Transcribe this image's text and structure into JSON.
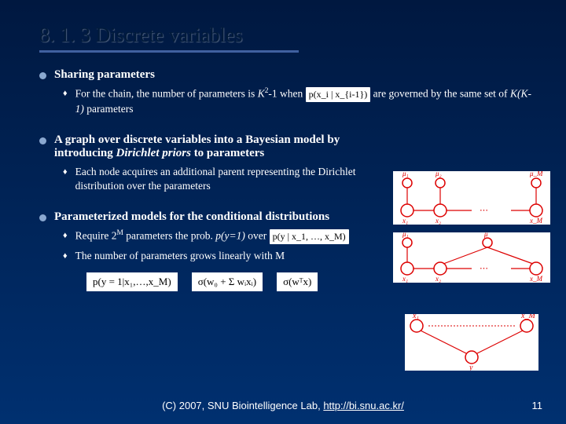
{
  "title": "8. 1. 3 Discrete variables",
  "bullets": {
    "b1": {
      "label": "Sharing parameters",
      "sub1_pre": "For the chain, the number of parameters is ",
      "sub1_k2": "K",
      "sub1_mid": "-1 when ",
      "sub1_math": "p(x_i | x_{i-1})",
      "sub1_post": " are governed by the same set of ",
      "sub1_kk": "K(K-1)",
      "sub1_end": " parameters"
    },
    "b2": {
      "label_a": "A graph over discrete variables into a Bayesian model by introducing ",
      "label_b": "Dirichlet priors",
      "label_c": " to parameters",
      "sub1": "Each node acquires an additional parent representing the Dirichlet distribution over the parameters"
    },
    "b3": {
      "label": "Parameterized models for the conditional distributions",
      "sub1_a": "Require 2",
      "sub1_b": " parameters the prob. ",
      "sub1_c": "p(y=1)",
      "sub1_d": " over ",
      "sub1_math": "p(y | x_1, …, x_M)",
      "sub2": "The number of parameters grows linearly with M"
    }
  },
  "formulas": {
    "f1": "p(y = 1|x₁,…,x_M)",
    "f2": "σ(w₀ + Σ wᵢxᵢ)",
    "f3": "σ(wᵀx)"
  },
  "footer": {
    "text": "(C) 2007, SNU Biointelligence Lab, ",
    "link": "http://bi.snu.ac.kr/"
  },
  "page": "11"
}
